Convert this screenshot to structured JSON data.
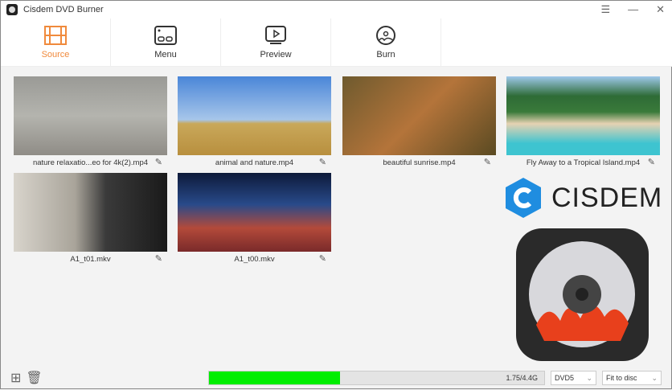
{
  "window": {
    "title": "Cisdem DVD Burner"
  },
  "tabs": [
    {
      "label": "Source",
      "active": true
    },
    {
      "label": "Menu"
    },
    {
      "label": "Preview"
    },
    {
      "label": "Burn"
    }
  ],
  "videos": [
    {
      "name": "nature relaxatio...eo for 4k(2).mp4"
    },
    {
      "name": "animal and nature.mp4"
    },
    {
      "name": "beautiful sunrise.mp4"
    },
    {
      "name": "Fly Away to a Tropical Island.mp4"
    },
    {
      "name": "A1_t01.mkv"
    },
    {
      "name": "A1_t00.mkv"
    }
  ],
  "footer": {
    "usage": "1.75/4.4G",
    "progress": 0.39,
    "disc_type": "DVD5",
    "quality": "Fit to disc"
  },
  "brand": {
    "logo_text": "CISDEM"
  },
  "colors": {
    "accent": "#f08a3c",
    "progress": "#00ee00"
  }
}
